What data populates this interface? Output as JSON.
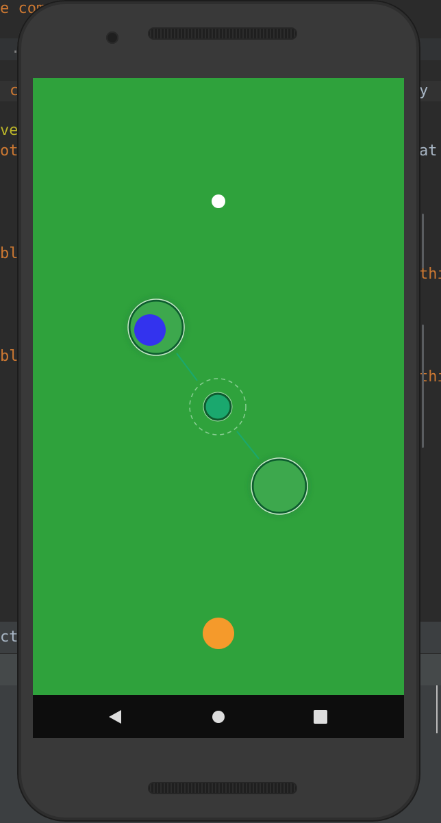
{
  "ide": {
    "fragments_left": [
      {
        "text": "e com",
        "color": "#cc7832"
      },
      {
        "text": ".",
        "color": "#808080"
      },
      {
        "text": "c",
        "color": "#cc7832"
      },
      {
        "text": "ve",
        "color": "#bbb529"
      },
      {
        "text": "ot",
        "color": "#cc7832"
      },
      {
        "text": "bl",
        "color": "#cc7832"
      },
      {
        "text": "bl",
        "color": "#cc7832"
      },
      {
        "text": "ctiv",
        "color": "#a9b7c6"
      }
    ],
    "fragments_right": [
      {
        "text": "y",
        "color": "#a9b7c6"
      },
      {
        "text": "at",
        "color": "#a9b7c6"
      },
      {
        "text": "thi",
        "color": "#cc7832"
      },
      {
        "text": "thi",
        "color": "#cc7832"
      }
    ]
  },
  "game": {
    "background_color": "#2fa23c",
    "target_color": "#ffffff",
    "player_color": "#3333ee",
    "goal_color": "#f59a2b",
    "node_color": "#3daa4e",
    "center_node_color": "#1aa86e"
  },
  "navbar": {
    "back": "back-icon",
    "home": "home-icon",
    "recents": "recents-icon"
  }
}
